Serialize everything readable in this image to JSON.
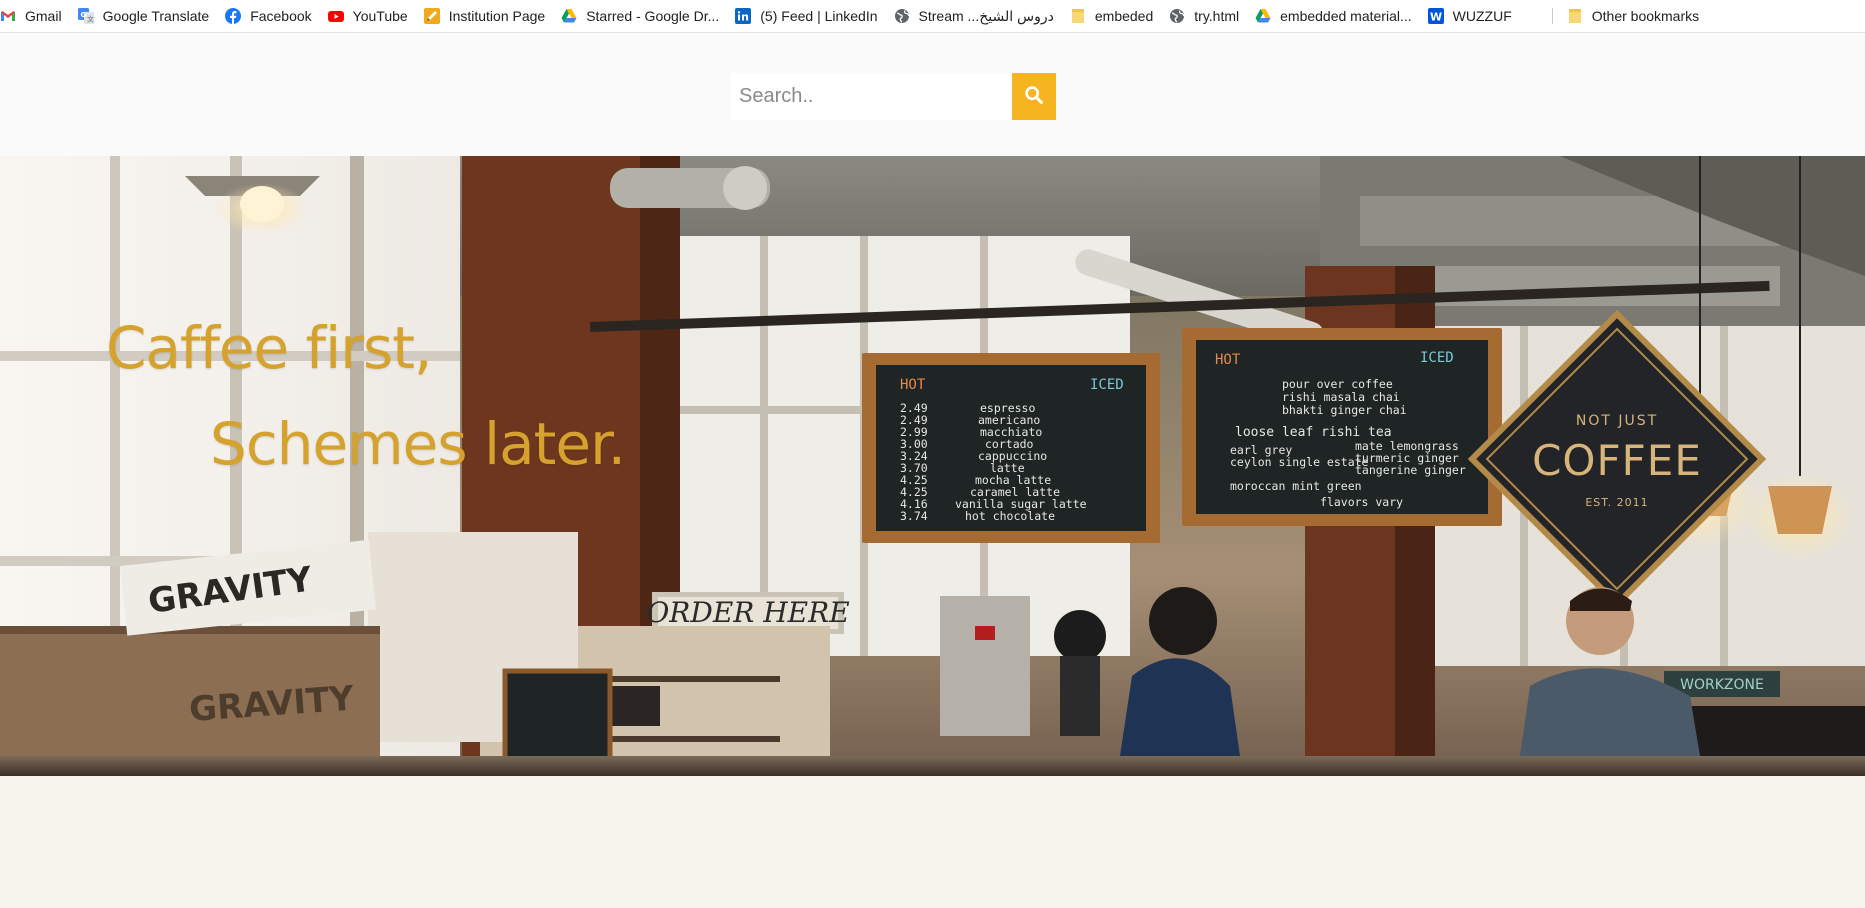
{
  "bookmarks": [
    {
      "label": "Gmail",
      "icon": "gmail-icon"
    },
    {
      "label": "Google Translate",
      "icon": "google-translate-icon"
    },
    {
      "label": "Facebook",
      "icon": "facebook-icon"
    },
    {
      "label": "YouTube",
      "icon": "youtube-icon"
    },
    {
      "label": "Institution Page",
      "icon": "pencil-page-icon"
    },
    {
      "label": "Starred - Google Dr...",
      "icon": "google-drive-icon"
    },
    {
      "label": "(5) Feed | LinkedIn",
      "icon": "linkedin-icon"
    },
    {
      "label": "Stream ...دروس الشيخ",
      "icon": "globe-icon"
    },
    {
      "label": "embeded",
      "icon": "folder-icon"
    },
    {
      "label": "try.html",
      "icon": "globe-icon"
    },
    {
      "label": "embedded material...",
      "icon": "google-drive-icon"
    },
    {
      "label": "WUZZUF",
      "icon": "wuzzuf-icon"
    },
    {
      "label": "Other bookmarks",
      "icon": "folder-icon"
    }
  ],
  "search": {
    "placeholder": "Search..",
    "value": "",
    "button_icon": "search-icon"
  },
  "hero": {
    "headline_line1": "Caffee first,",
    "headline_line2": "Schemes later.",
    "accent_color": "#d6a22e"
  },
  "scene": {
    "sign_order": "ORDER HERE",
    "sign_coffee_top": "NOT JUST",
    "sign_coffee_main": "COFFEE",
    "sign_coffee_est": "EST. 2011",
    "sign_workzone": "WORKZONE",
    "crate_brand": "GRAVITY",
    "menu_left": {
      "hot": "HOT",
      "iced": "ICED",
      "items": [
        "espresso",
        "americano",
        "macchiato",
        "cortado",
        "cappuccino",
        "latte",
        "mocha latte",
        "caramel latte",
        "vanilla sugar latte",
        "hot chocolate"
      ],
      "prices": [
        "2.49",
        "2.49",
        "2.99",
        "3.00",
        "3.24",
        "3.70",
        "4.25",
        "4.25",
        "4.16",
        "3.74"
      ]
    },
    "menu_right": {
      "hot": "HOT",
      "iced": "ICED",
      "items": [
        "pour over coffee",
        "rishi masala chai",
        "bhakti ginger chai",
        "loose leaf rishi tea",
        "earl grey",
        "mate lemongrass",
        "ceylon single estate",
        "turmeric ginger",
        "moroccan mint green",
        "tangerine ginger",
        "flavors vary"
      ]
    }
  },
  "colors": {
    "search_button": "#f6b520",
    "header_bg": "#fafafa"
  }
}
